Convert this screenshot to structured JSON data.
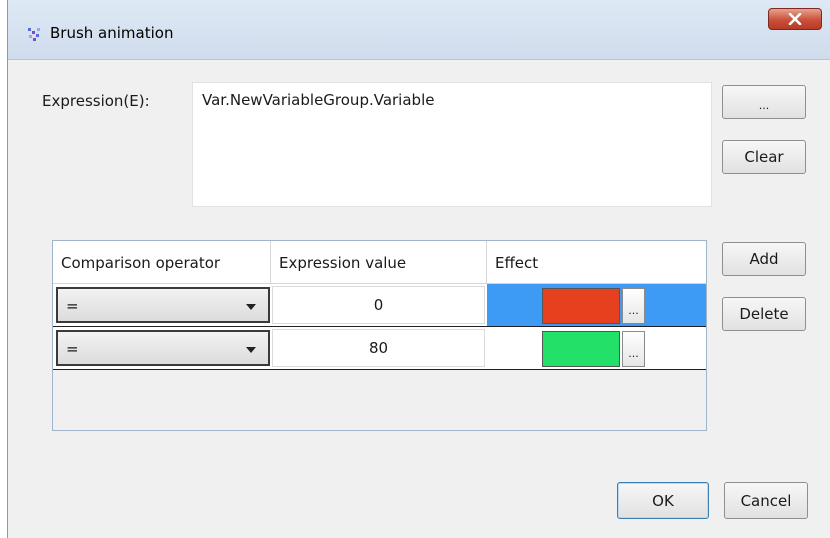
{
  "window": {
    "title": "Brush animation"
  },
  "expression": {
    "label": "Expression(E):",
    "value": "Var.NewVariableGroup.Variable"
  },
  "side_buttons": {
    "browse": "...",
    "clear": "Clear",
    "add": "Add",
    "delete": "Delete"
  },
  "table": {
    "columns": [
      "Comparison operator",
      "Expression value",
      "Effect"
    ],
    "rows": [
      {
        "operator": "=",
        "value": "0",
        "color": "#e5411f",
        "dots": "...",
        "selected": true
      },
      {
        "operator": "=",
        "value": "80",
        "color": "#23e069",
        "dots": "...",
        "selected": false
      }
    ]
  },
  "footer": {
    "ok": "OK",
    "cancel": "Cancel"
  },
  "colors": {
    "selection": "#3d9bf5",
    "close_button": "#c9503a"
  }
}
